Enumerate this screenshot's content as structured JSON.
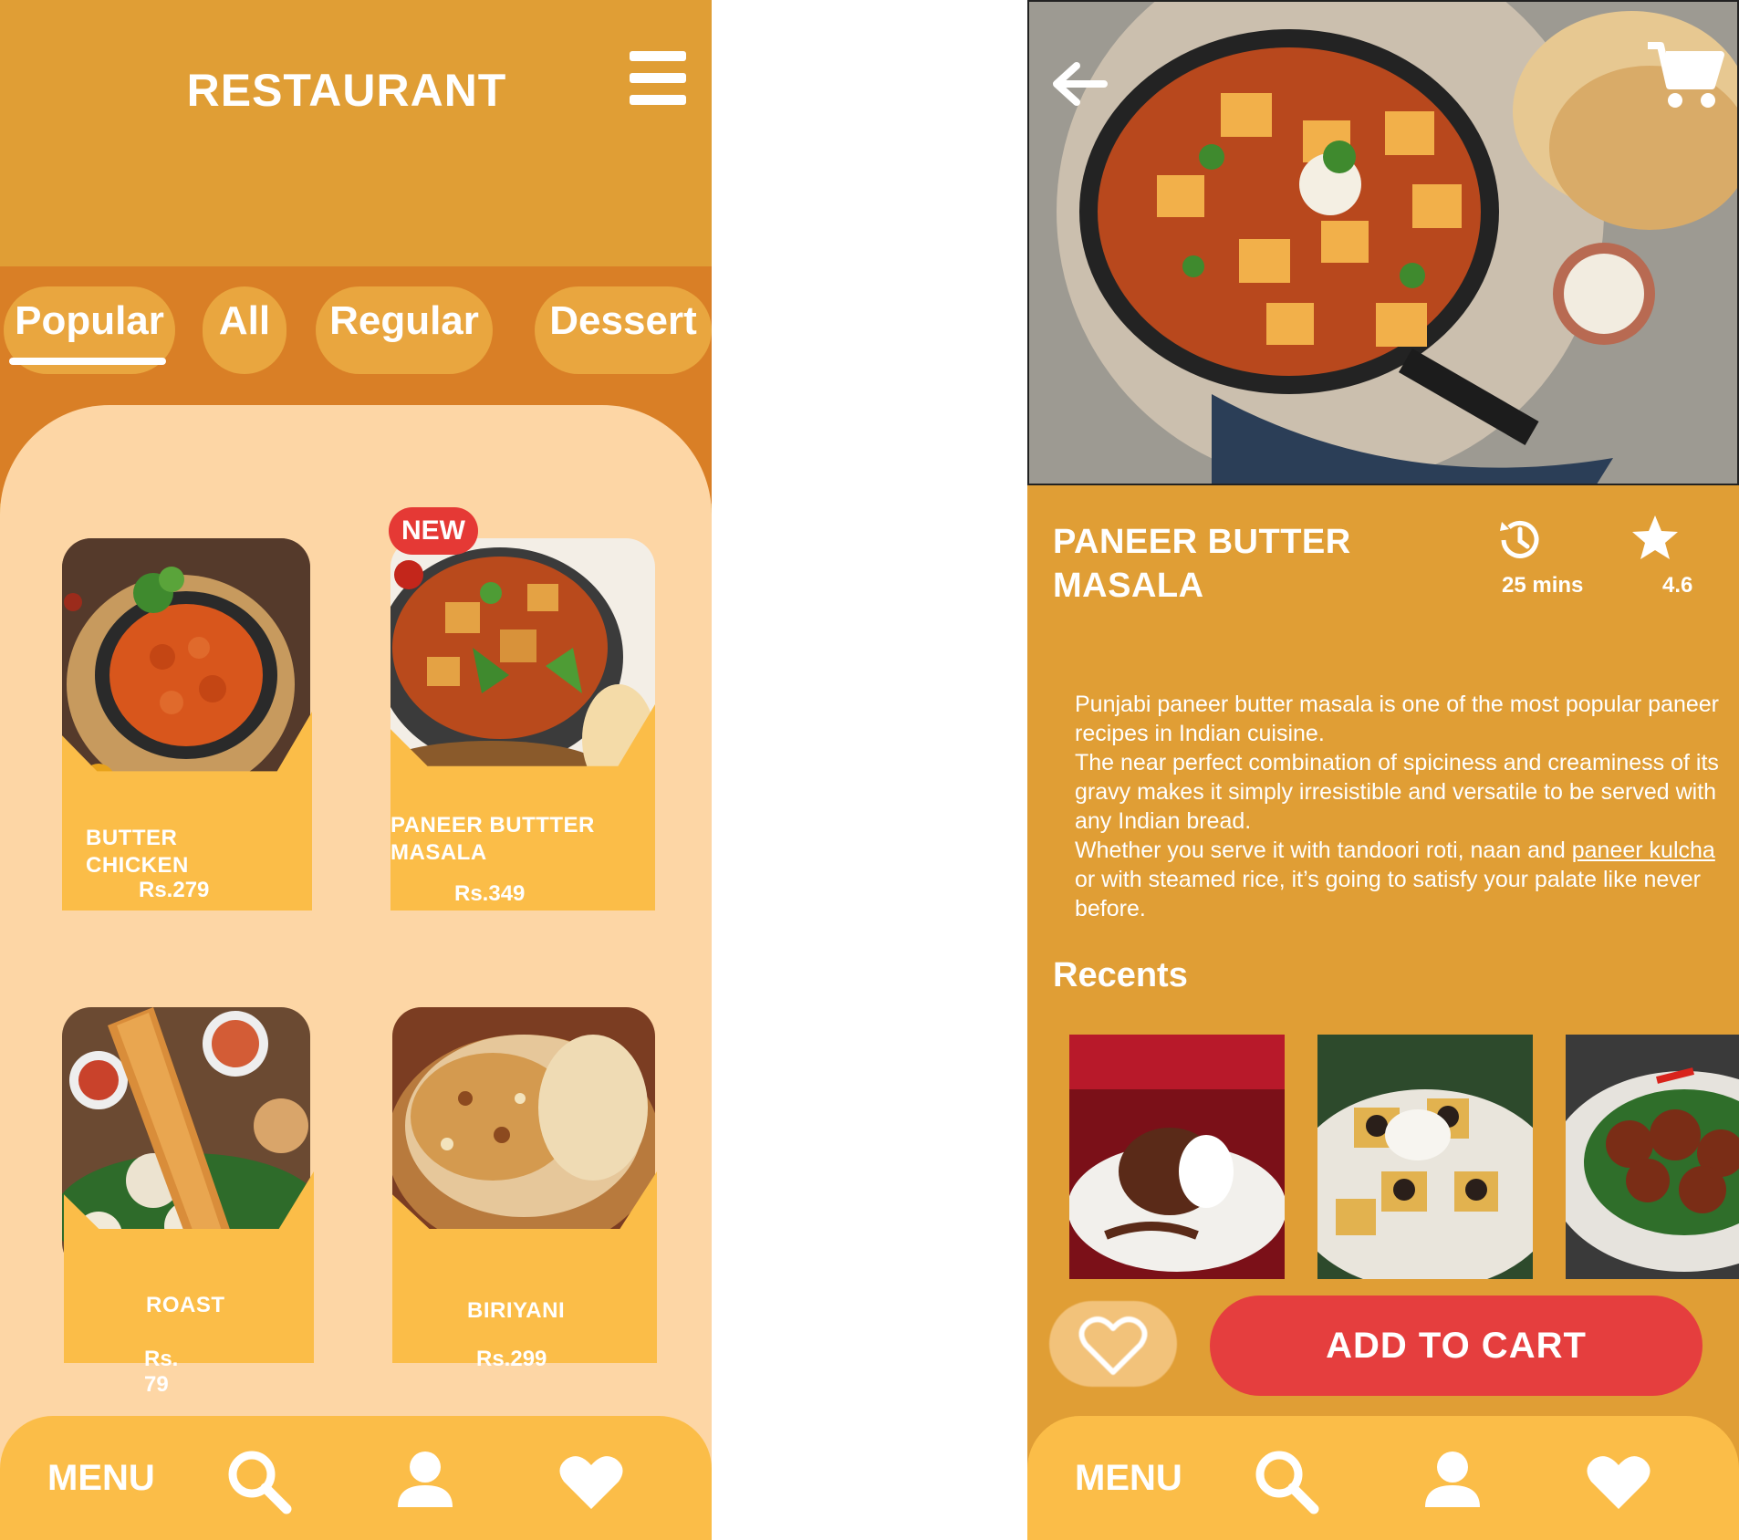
{
  "list_screen": {
    "title": "RESTAURANT",
    "tabs": [
      {
        "label": "Popular",
        "active": true
      },
      {
        "label": "All",
        "active": false
      },
      {
        "label": "Regular",
        "active": false
      },
      {
        "label": "Dessert",
        "active": false
      }
    ],
    "new_badge": "NEW",
    "items": [
      {
        "name": "BUTTER CHICKEN",
        "price": "Rs.279"
      },
      {
        "name": "PANEER BUTTTER MASALA",
        "price": "Rs.349"
      },
      {
        "name": "ROAST",
        "price": "Rs. 79"
      },
      {
        "name": "BIRIYANI",
        "price": "Rs.299"
      }
    ]
  },
  "nav": {
    "menu_label": "MENU",
    "icons": [
      "search-icon",
      "user-icon",
      "heart-icon"
    ]
  },
  "detail_screen": {
    "dish_name": "PANEER BUTTER MASALA",
    "time": "25 mins",
    "rating": "4.6",
    "description": {
      "line1": "Punjabi paneer butter masala is one of the most popular paneer recipes in Indian cuisine.",
      "line2": "The near perfect combination of spiciness and creaminess of its gravy makes it simply irresistible and versatile to be served with any Indian bread.",
      "line3_pre": "Whether you serve it with tandoori roti, naan and ",
      "line3_link": "paneer kulcha",
      "line3_post": " or with steamed rice, it’s going to satisfy your palate like never before."
    },
    "recents_label": "Recents",
    "add_to_cart": "ADD TO CART"
  },
  "colors": {
    "background": "#e09e35",
    "tab_band": "#d97f26",
    "content_panel": "#fdd6a5",
    "card_plate": "#fbbd48",
    "new_badge": "#e53935",
    "cart_button": "#e53e3e"
  }
}
